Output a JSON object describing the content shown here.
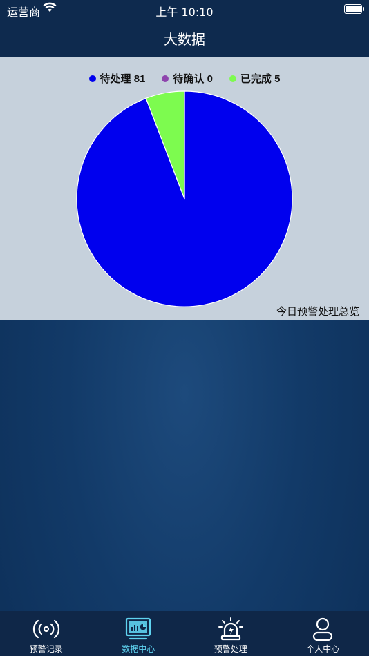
{
  "status_bar": {
    "carrier": "运营商",
    "time": "上午 10:10"
  },
  "nav": {
    "title": "大数据"
  },
  "chart_data": {
    "type": "pie",
    "caption": "今日预警处理总览",
    "slices": [
      {
        "label": "待处理",
        "value": 81,
        "color": "#0000ee"
      },
      {
        "label": "待确认",
        "value": 0,
        "color": "#8e44ad"
      },
      {
        "label": "已完成",
        "value": 5,
        "color": "#7dfb4f"
      }
    ],
    "legend_position": "top"
  },
  "legend": {
    "items": [
      {
        "text": "待处理 81",
        "color": "#0000ee"
      },
      {
        "text": "待确认 0",
        "color": "#8e44ad"
      },
      {
        "text": "已完成 5",
        "color": "#7dfb4f"
      }
    ]
  },
  "tabs": [
    {
      "label": "预警记录",
      "icon": "broadcast-icon",
      "active": false
    },
    {
      "label": "数据中心",
      "icon": "dashboard-monitor-icon",
      "active": true
    },
    {
      "label": "预警处理",
      "icon": "alarm-light-icon",
      "active": false
    },
    {
      "label": "个人中心",
      "icon": "person-icon",
      "active": false
    }
  ],
  "colors": {
    "nav_bg": "#0e2a4e",
    "active_tab": "#5fd3f0"
  }
}
